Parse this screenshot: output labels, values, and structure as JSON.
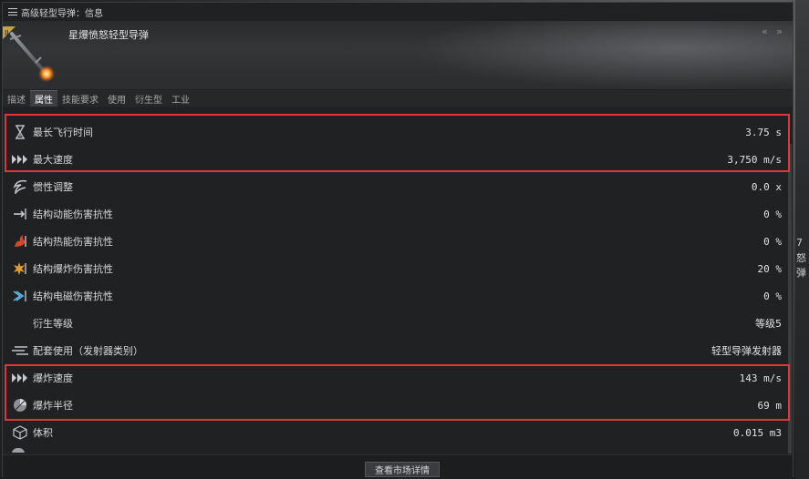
{
  "window": {
    "title": "高级轻型导弹：信息",
    "item_name": "星爆愤怒轻型导弹",
    "collapse_glyph": "« »"
  },
  "tabs": [
    "描述",
    "属性",
    "技能要求",
    "使用",
    "衍生型",
    "工业"
  ],
  "active_tab": "属性",
  "attributes": [
    {
      "icon": "hourglass-icon",
      "label": "最长飞行时间",
      "value": "3.75 s"
    },
    {
      "icon": "velocity-icon",
      "label": "最大速度",
      "value": "3,750 m/s"
    },
    {
      "icon": "inertia-icon",
      "label": "惯性调整",
      "value": "0.0 x"
    },
    {
      "icon": "kinetic-resist-icon",
      "label": "结构动能伤害抗性",
      "value": "0 %"
    },
    {
      "icon": "thermal-resist-icon",
      "label": "结构热能伤害抗性",
      "value": "0 %"
    },
    {
      "icon": "explosive-resist-icon",
      "label": "结构爆炸伤害抗性",
      "value": "20 %"
    },
    {
      "icon": "em-resist-icon",
      "label": "结构电磁伤害抗性",
      "value": "0 %"
    },
    {
      "icon": "",
      "label": "衍生等级",
      "value": "等级5"
    },
    {
      "icon": "launcher-group-icon",
      "label": "配套使用（发射器类别）",
      "value": "轻型导弹发射器"
    },
    {
      "icon": "explosion-velocity-icon",
      "label": "爆炸速度",
      "value": "143 m/s"
    },
    {
      "icon": "explosion-radius-icon",
      "label": "爆炸半径",
      "value": "69 m"
    },
    {
      "icon": "volume-icon",
      "label": "体积",
      "value": "0.015 m3"
    }
  ],
  "footer": {
    "market_button": "查看市场详情"
  },
  "colors": {
    "highlight": "#e0373d",
    "active_tab_bg": "#3c3e41"
  },
  "side_partial_text": [
    "7",
    "怒",
    "弹"
  ]
}
